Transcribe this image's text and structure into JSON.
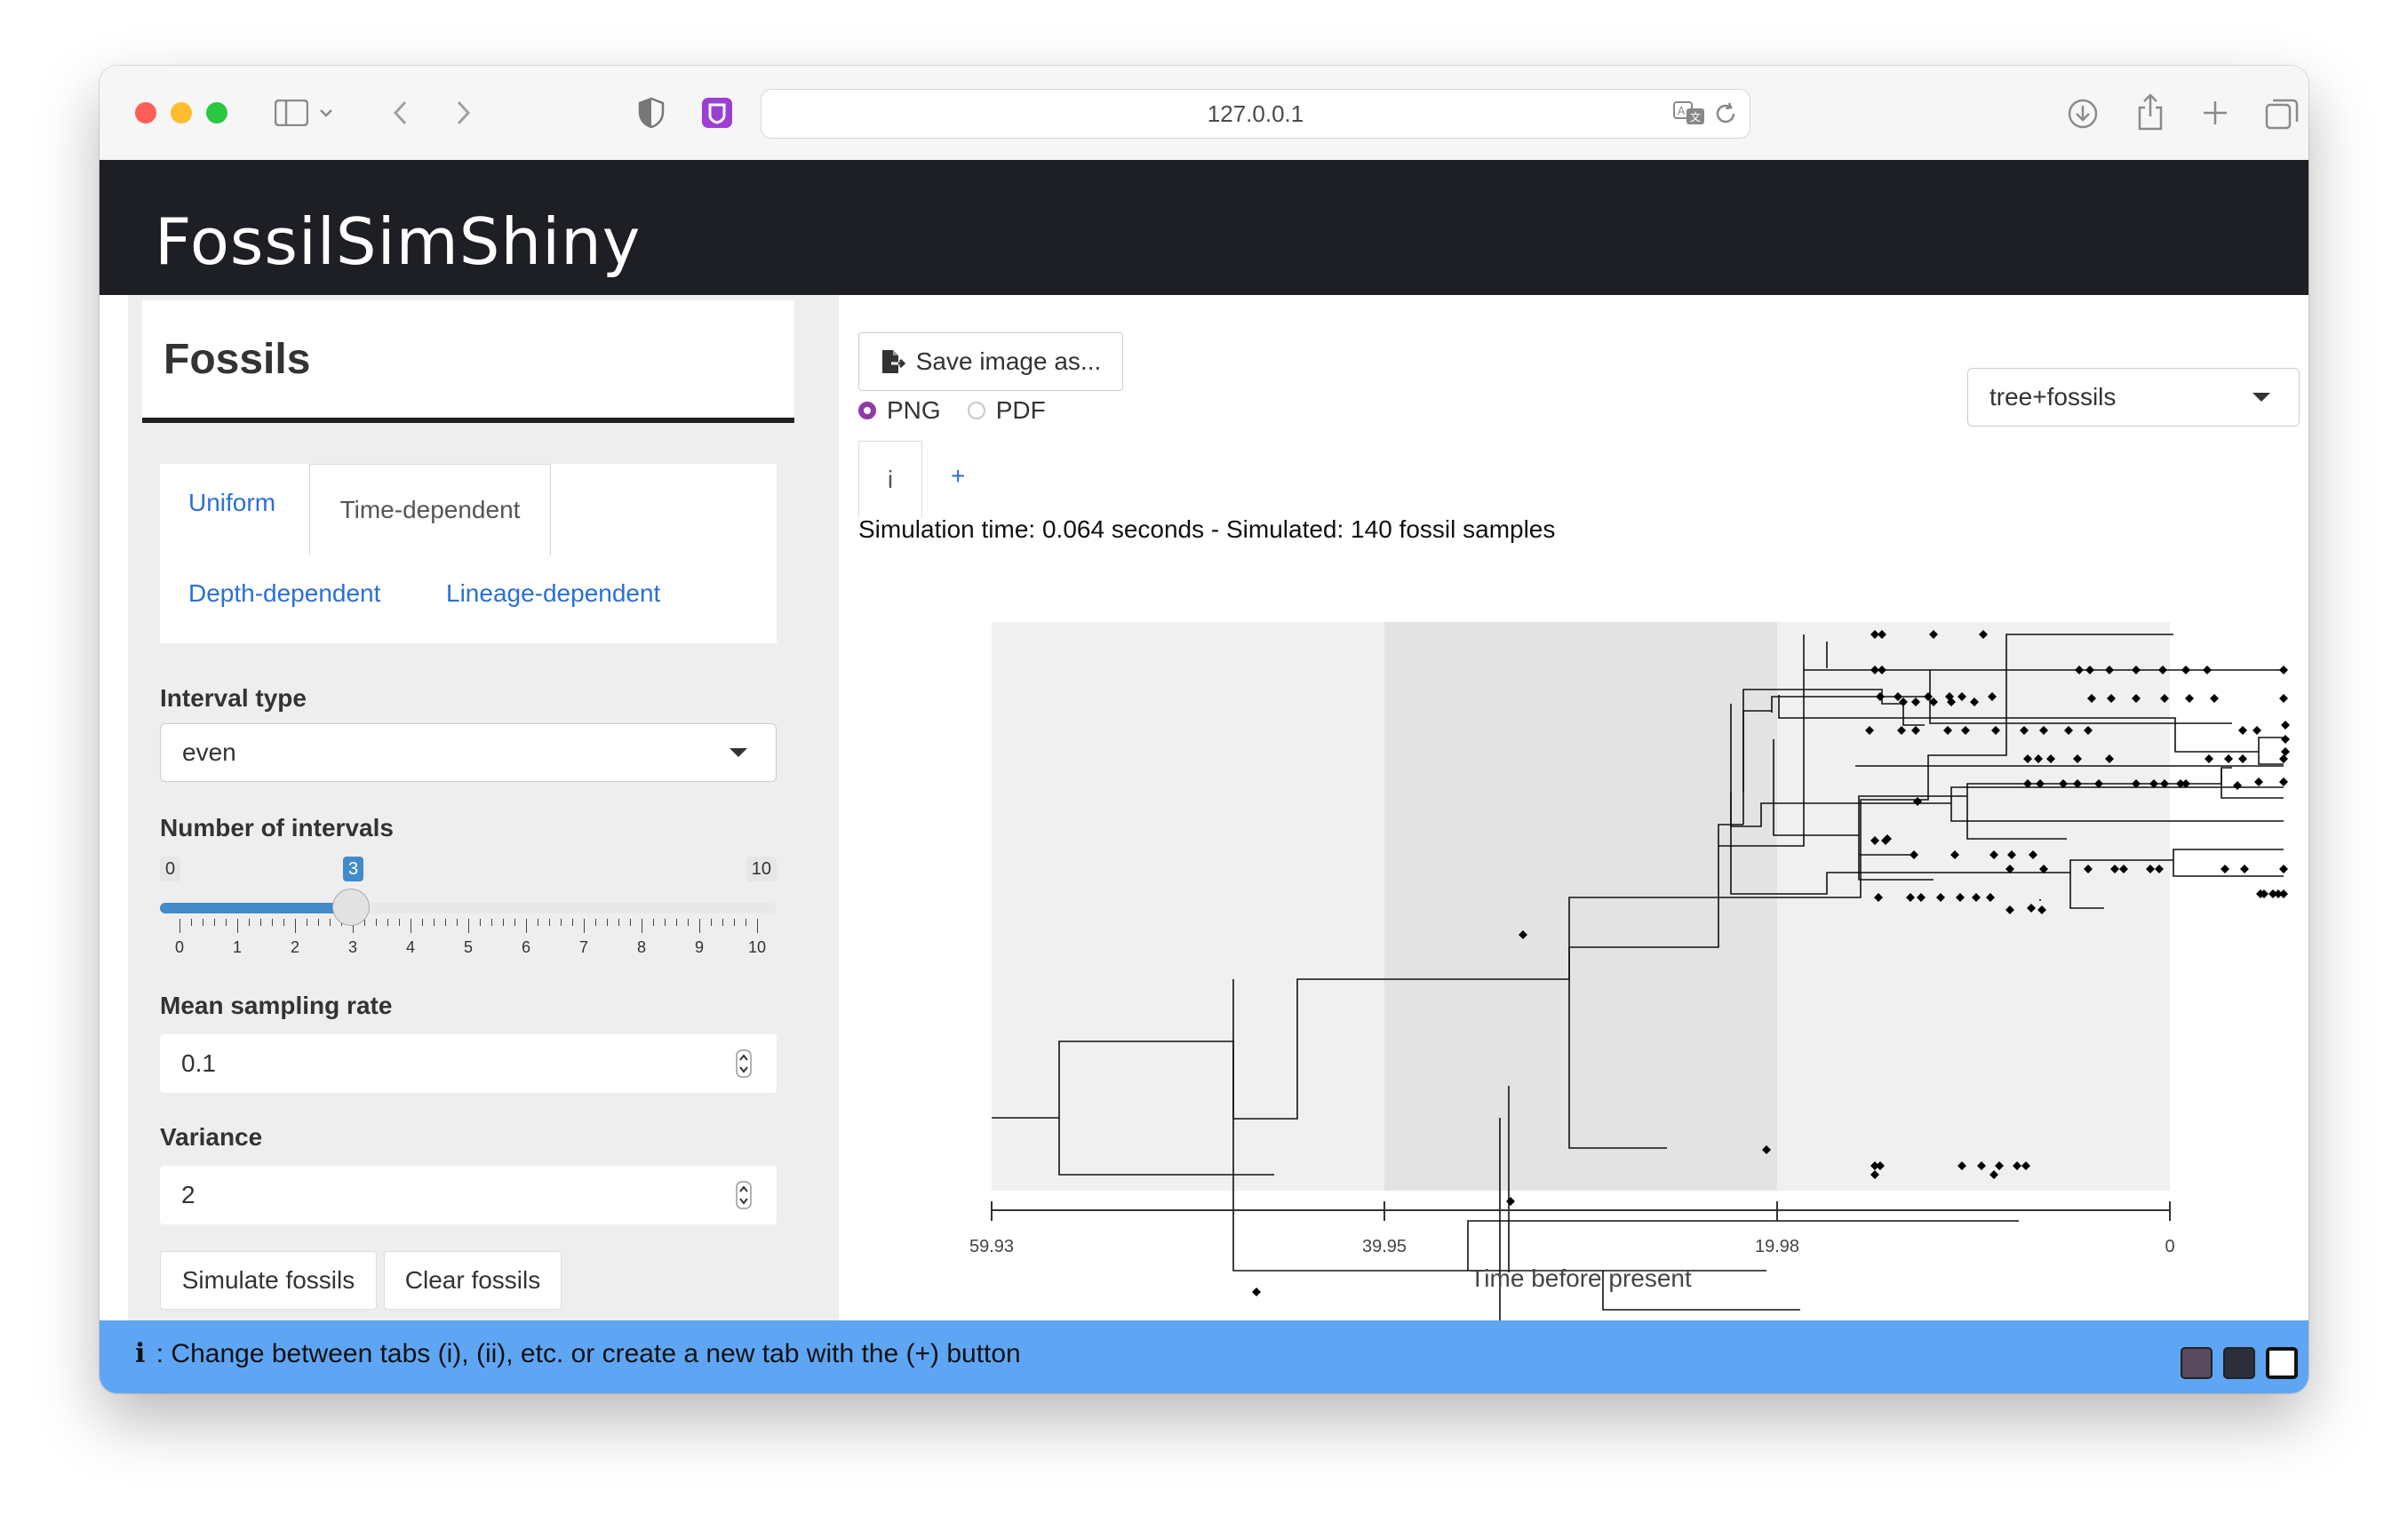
{
  "browser": {
    "url": "127.0.0.1"
  },
  "app": {
    "title": "FossilSimShiny"
  },
  "sidebar": {
    "panel_title": "Fossils",
    "tabs": [
      {
        "label": "Uniform"
      },
      {
        "label": "Time-dependent"
      },
      {
        "label": "Depth-dependent"
      },
      {
        "label": "Lineage-dependent"
      }
    ],
    "active_tab": "Time-dependent",
    "interval_type": {
      "label": "Interval type",
      "value": "even"
    },
    "num_intervals": {
      "label": "Number of intervals",
      "min": "0",
      "max": "10",
      "value": "3",
      "tick_labels": [
        "0",
        "1",
        "2",
        "3",
        "4",
        "5",
        "6",
        "7",
        "8",
        "9",
        "10"
      ]
    },
    "mean_sampling_rate": {
      "label": "Mean sampling rate",
      "value": "0.1"
    },
    "variance": {
      "label": "Variance",
      "value": "2"
    },
    "buttons": {
      "simulate": "Simulate fossils",
      "clear": "Clear fossils"
    }
  },
  "main": {
    "save_button": "Save image as...",
    "formats": [
      {
        "label": "PNG",
        "selected": true
      },
      {
        "label": "PDF",
        "selected": false
      }
    ],
    "plot_tabs": [
      {
        "label": "i"
      }
    ],
    "add_tab": "+",
    "plot_type": "tree+fossils",
    "simulation_status": "Simulation time: 0.064 seconds - Simulated: 140 fossil samples"
  },
  "plot": {
    "x_axis_title": "Time before present",
    "x_tick_labels": [
      "59.93",
      "39.95",
      "19.98",
      "0"
    ]
  },
  "chart_data": {
    "type": "scatter",
    "xlabel": "Time before present",
    "x_ticks": [
      59.93,
      39.95,
      19.98,
      0
    ],
    "x_reversed": true,
    "interval_bounds": [
      59.93,
      39.95,
      19.98,
      0
    ]
  },
  "footer": {
    "icon": "i",
    "text": ": Change between tabs (i), (ii), etc. or create a new tab with the (+) button"
  },
  "colors": {
    "header_bg": "#1d1f24",
    "footer_bg": "#5ea6f4",
    "accent_blue": "#428bca",
    "link_blue": "#2a6fd6",
    "radio_purple": "#8e3aa8"
  }
}
